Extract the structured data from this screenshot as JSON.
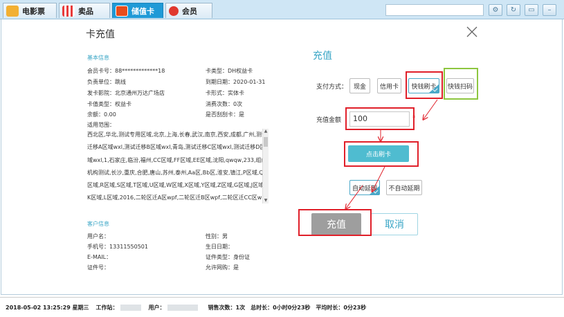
{
  "tabs": [
    {
      "label": "电影票",
      "color": "#f2b033"
    },
    {
      "label": "卖品",
      "color": "#e83b3b"
    },
    {
      "label": "储值卡",
      "color": "#e84c1c"
    },
    {
      "label": "会员",
      "color": "#e0392f"
    }
  ],
  "modal": {
    "title": "卡充值",
    "basic_info": {
      "title": "基本信息",
      "card_no": "会员卡号：88*************18",
      "card_type": "卡类型：DH权益卡",
      "unit": "负责单位：跳线",
      "expire": "到期日期：2020-01-31",
      "issuer": "发卡影院：北京通州万达广场店",
      "card_form": "卡形式：实体卡",
      "value_type": "卡值类型：权益卡",
      "consume_count": "消费次数：0次",
      "balance": "余额：0.00",
      "swipe": "是否刮刮卡：是",
      "scope_label": "适用范围：",
      "scope_text": "西北区,华北,测试专用区域,北京,上海,长春,武汉,南京,西安,成都,广州,测试迁移A区域wxl,测试迁移B区域wxl,青岛,测试迁移C区域wxl,测试迁移D区域wxl,1,石家庄,临汾,福州,CC区域,FF区域,EE区域,沈阳,qwqw,233,组织机构测试,长沙,重庆,合肥,唐山,苏州,泰州,Aa区,Bb区,淮安,镇江,P区域,Q区域,R区域,S区域,T区域,U区域,W区域,X区域,Y区域,Z区域,G区域,J区域,K区域,L区域,2016,二轮区迁A区wpf,二轮区迁B区wpf,二轮区迁CC区wpf,区域迁移A区wpf,区域迁移B区wpf,区"
    },
    "customer_info": {
      "title": "客户信息",
      "username": "用户名：",
      "gender": "性别：男",
      "phone": "手机号：13311550501",
      "birthday": "生日日期：",
      "email": "E-MAIL：",
      "id_type": "证件类型：身份证",
      "id_no": "证件号：",
      "allow_online": "允许网购：是"
    },
    "recharge": {
      "title": "充值",
      "pay_label": "支付方式：",
      "pay_methods": [
        "现金",
        "信用卡",
        "快钱刷卡",
        "快钱扫码"
      ],
      "amount_label": "充值金额",
      "amount_value": "100",
      "required_mark": "*",
      "swipe_button": "点击刷卡",
      "auto_extend": "自动延期",
      "no_auto_extend": "不自动延期",
      "submit": "充值",
      "cancel": "取消"
    }
  },
  "status": {
    "datetime": "2018-05-02 13:25:29 星期三",
    "workstation": "工作站：",
    "user": "用户：",
    "sales": "销售次数：1次",
    "total_time": "总时长：0小时0分23秒",
    "avg_time": "平均时长：0分23秒"
  },
  "colors": {
    "accent": "#3aa6c6",
    "highlight_red": "#e0202a",
    "highlight_green": "#8dc63f",
    "active_tab": "#1f9ad7"
  }
}
